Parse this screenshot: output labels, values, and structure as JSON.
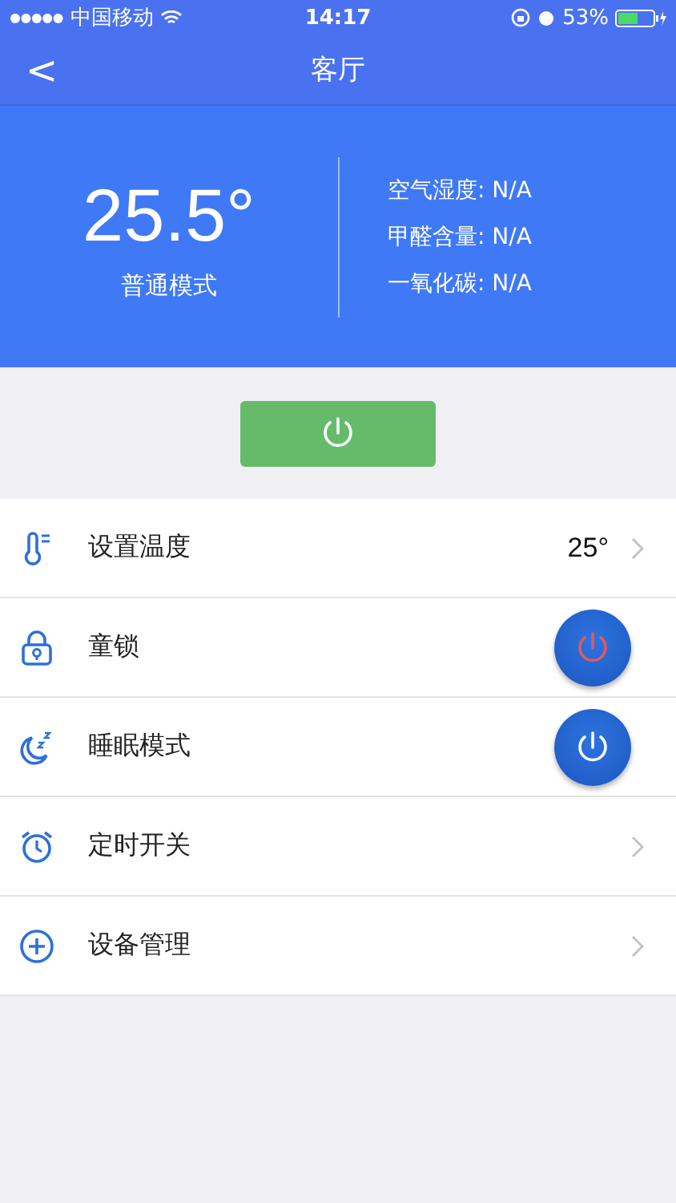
{
  "status_bar": {
    "carrier": "中国移动",
    "time": "14:17",
    "battery": "53%"
  },
  "nav": {
    "back": "<",
    "title": "客厅"
  },
  "hero": {
    "temperature": "25.5°",
    "mode": "普通模式",
    "readings": [
      "空气湿度: N/A",
      "甲醛含量: N/A",
      "一氧化碳: N/A"
    ]
  },
  "power_button": {
    "on": true
  },
  "rows": [
    {
      "kind": "value",
      "label": "设置温度",
      "value": "25°"
    },
    {
      "kind": "toggle",
      "label": "童锁",
      "on": false
    },
    {
      "kind": "toggle",
      "label": "睡眠模式",
      "on": true
    },
    {
      "kind": "link",
      "label": "定时开关"
    },
    {
      "kind": "link",
      "label": "设备管理"
    }
  ]
}
